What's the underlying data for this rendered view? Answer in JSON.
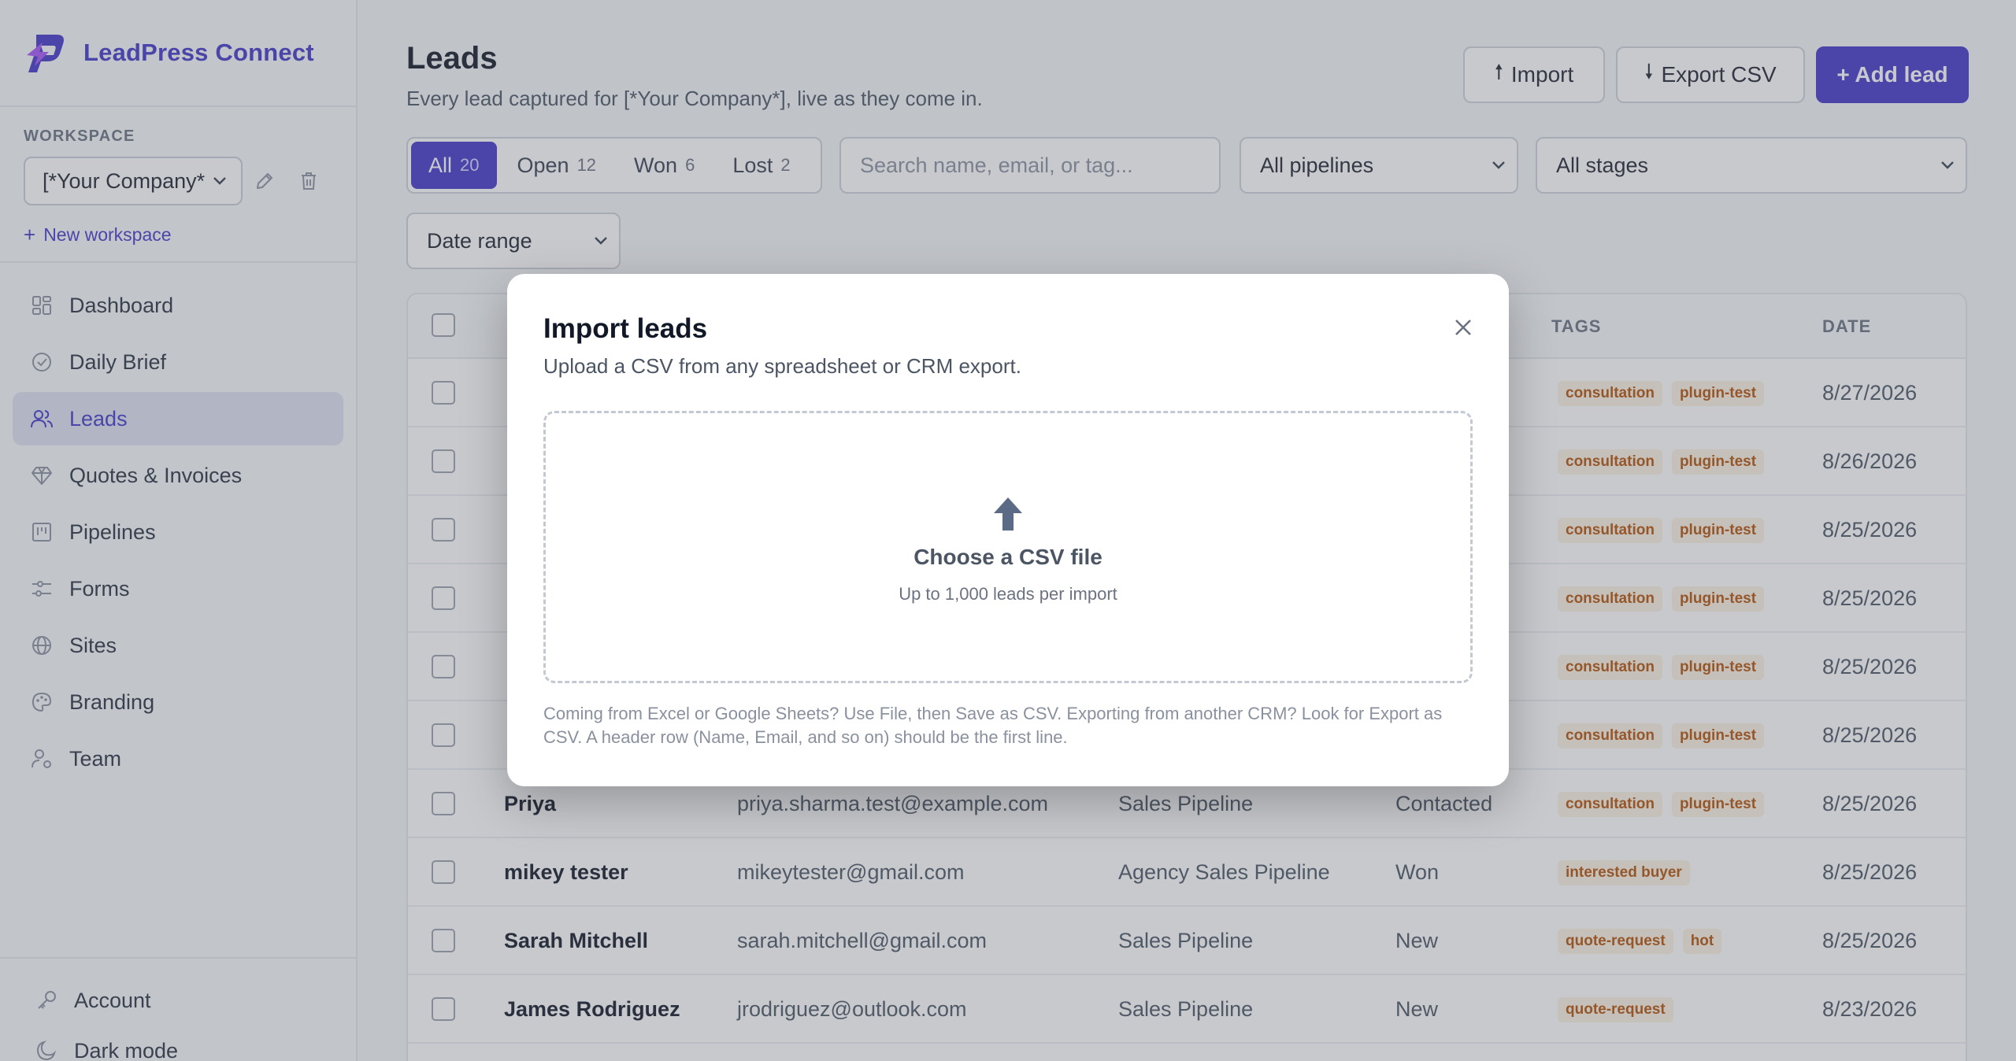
{
  "brand": {
    "name": "LeadPress Connect"
  },
  "workspace": {
    "label": "WORKSPACE",
    "selected": "[*Your Company*",
    "new_label": "New workspace"
  },
  "nav": {
    "items": [
      {
        "label": "Dashboard",
        "icon": "grid-icon"
      },
      {
        "label": "Daily Brief",
        "icon": "check-circle-icon"
      },
      {
        "label": "Leads",
        "icon": "users-icon",
        "active": true
      },
      {
        "label": "Quotes & Invoices",
        "icon": "gem-icon"
      },
      {
        "label": "Pipelines",
        "icon": "kanban-icon"
      },
      {
        "label": "Forms",
        "icon": "form-icon"
      },
      {
        "label": "Sites",
        "icon": "globe-icon"
      },
      {
        "label": "Branding",
        "icon": "palette-icon"
      },
      {
        "label": "Team",
        "icon": "user-gear-icon"
      }
    ],
    "account": "Account",
    "dark_mode": "Dark mode"
  },
  "header": {
    "title": "Leads",
    "subtitle": "Every lead captured for [*Your Company*], live as they come in.",
    "import_label": "Import",
    "export_label": "Export CSV",
    "add_label": "+ Add lead"
  },
  "filters": {
    "segments": [
      {
        "label": "All",
        "count": "20"
      },
      {
        "label": "Open",
        "count": "12"
      },
      {
        "label": "Won",
        "count": "6"
      },
      {
        "label": "Lost",
        "count": "2"
      }
    ],
    "search_placeholder": "Search name, email, or tag...",
    "pipeline": "All pipelines",
    "stage": "All stages",
    "date": "Date range"
  },
  "table": {
    "headers": {
      "tags": "TAGS",
      "date": "DATE"
    },
    "rows": [
      {
        "name": "",
        "email": "",
        "pipeline": "",
        "stage": "",
        "tags": [
          "consultation",
          "plugin-test"
        ],
        "date": "8/27/2026"
      },
      {
        "name": "",
        "email": "",
        "pipeline": "",
        "stage": "",
        "tags": [
          "consultation",
          "plugin-test"
        ],
        "date": "8/26/2026"
      },
      {
        "name": "",
        "email": "",
        "pipeline": "",
        "stage": "",
        "tags": [
          "consultation",
          "plugin-test"
        ],
        "date": "8/25/2026"
      },
      {
        "name": "",
        "email": "",
        "pipeline": "",
        "stage": "",
        "tags": [
          "consultation",
          "plugin-test"
        ],
        "date": "8/25/2026"
      },
      {
        "name": "",
        "email": "",
        "pipeline": "",
        "stage": "",
        "tags": [
          "consultation",
          "plugin-test"
        ],
        "date": "8/25/2026"
      },
      {
        "name": "",
        "email": "",
        "pipeline": "",
        "stage": "",
        "tags": [
          "consultation",
          "plugin-test"
        ],
        "date": "8/25/2026"
      },
      {
        "name": "Priya",
        "email": "priya.sharma.test@example.com",
        "pipeline": "Sales Pipeline",
        "stage": "Contacted",
        "tags": [
          "consultation",
          "plugin-test"
        ],
        "date": "8/25/2026"
      },
      {
        "name": "mikey tester",
        "email": "mikeytester@gmail.com",
        "pipeline": "Agency Sales Pipeline",
        "stage": "Won",
        "tags": [
          "interested buyer"
        ],
        "date": "8/25/2026"
      },
      {
        "name": "Sarah Mitchell",
        "email": "sarah.mitchell@gmail.com",
        "pipeline": "Sales Pipeline",
        "stage": "New",
        "tags": [
          "quote-request",
          "hot"
        ],
        "date": "8/25/2026"
      },
      {
        "name": "James Rodriguez",
        "email": "jrodriguez@outlook.com",
        "pipeline": "Sales Pipeline",
        "stage": "New",
        "tags": [
          "quote-request"
        ],
        "date": "8/23/2026"
      }
    ]
  },
  "modal": {
    "title": "Import leads",
    "subtitle": "Upload a CSV from any spreadsheet or CRM export.",
    "dropzone_title": "Choose a CSV file",
    "dropzone_sub": "Up to 1,000 leads per import",
    "hint": "Coming from Excel or Google Sheets? Use File, then Save as CSV. Exporting from another CRM? Look for Export as CSV. A header row (Name, Email, and so on) should be the first line."
  },
  "colors": {
    "accent": "#4338ca",
    "tag_text": "#b45309",
    "tag_bg": "#fdf1e3"
  }
}
